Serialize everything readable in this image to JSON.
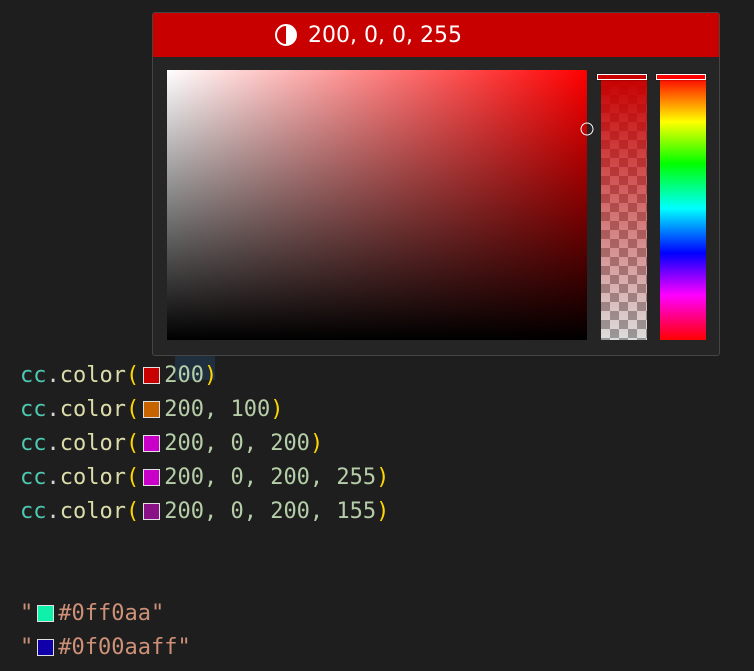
{
  "picker": {
    "header_value": "200, 0, 0, 255",
    "header_color": "#c80000",
    "header_icon": "contrast-icon",
    "saturation_value": {
      "hue_color": "#ff0000",
      "saturation": 1.0,
      "brightness": 0.78
    },
    "alpha": {
      "color": "#c80000",
      "level": 1.0
    },
    "hue": {
      "level": 0.0
    }
  },
  "editor": {
    "lines": [
      {
        "prefix": "cc",
        "dot": ".",
        "fn": "color",
        "open": "(",
        "swatch": "#c80000",
        "args": "200",
        "close": ")"
      },
      {
        "prefix": "cc",
        "dot": ".",
        "fn": "color",
        "open": "(",
        "swatch": "#c86400",
        "args": "200, 100",
        "close": ")"
      },
      {
        "prefix": "cc",
        "dot": ".",
        "fn": "color",
        "open": "(",
        "swatch": "#c800c8",
        "args": "200, 0, 200",
        "close": ")"
      },
      {
        "prefix": "cc",
        "dot": ".",
        "fn": "color",
        "open": "(",
        "swatch": "#c800c8",
        "args": "200, 0, 200, 255",
        "close": ")"
      },
      {
        "prefix": "cc",
        "dot": ".",
        "fn": "color",
        "open": "(",
        "swatch": "#8a1287",
        "args": "200, 0, 200, 155",
        "close": ")"
      }
    ],
    "strings": [
      {
        "quote_open": "\"",
        "swatch": "#0ff0aa",
        "value": "#0ff0aa\""
      },
      {
        "quote_open": "\"",
        "swatch": "#0f00aa",
        "value": "#0f00aaff\""
      }
    ]
  }
}
